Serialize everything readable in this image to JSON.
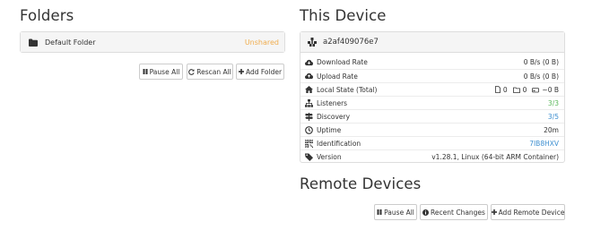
{
  "folders": {
    "title": "Folders",
    "items": [
      {
        "name": "Default Folder",
        "status": "Unshared",
        "status_color": "#f0ad4e"
      }
    ],
    "buttons": {
      "pause_all": "Pause All",
      "rescan_all": "Rescan All",
      "add_folder": "Add Folder"
    }
  },
  "this_device": {
    "title": "This Device",
    "device_name": "a2af409076e7",
    "stats": {
      "download_label": "Download Rate",
      "download_value": "0 B/s (0 B)",
      "upload_label": "Upload Rate",
      "upload_value": "0 B/s (0 B)",
      "local_state_label": "Local State (Total)",
      "local_files": "0",
      "local_dirs": "0",
      "local_size": "~0 B",
      "listeners_label": "Listeners",
      "listeners_value": "3/3",
      "discovery_label": "Discovery",
      "discovery_value": "3/5",
      "uptime_label": "Uptime",
      "uptime_value": "20m",
      "identification_label": "Identification",
      "identification_value": "7IB8HXV",
      "version_label": "Version",
      "version_value": "v1.28.1, Linux (64-bit ARM Container)"
    }
  },
  "remote_devices": {
    "title": "Remote Devices",
    "buttons": {
      "pause_all": "Pause All",
      "recent_changes": "Recent Changes",
      "add_remote_device": "Add Remote Device"
    }
  },
  "colors": {
    "link": "#3d8fd0",
    "ok_green": "#5cb85c",
    "unshared_orange": "#f0ad4e",
    "panel_header_bg": "#f5f5f5",
    "border": "#dddddd"
  }
}
